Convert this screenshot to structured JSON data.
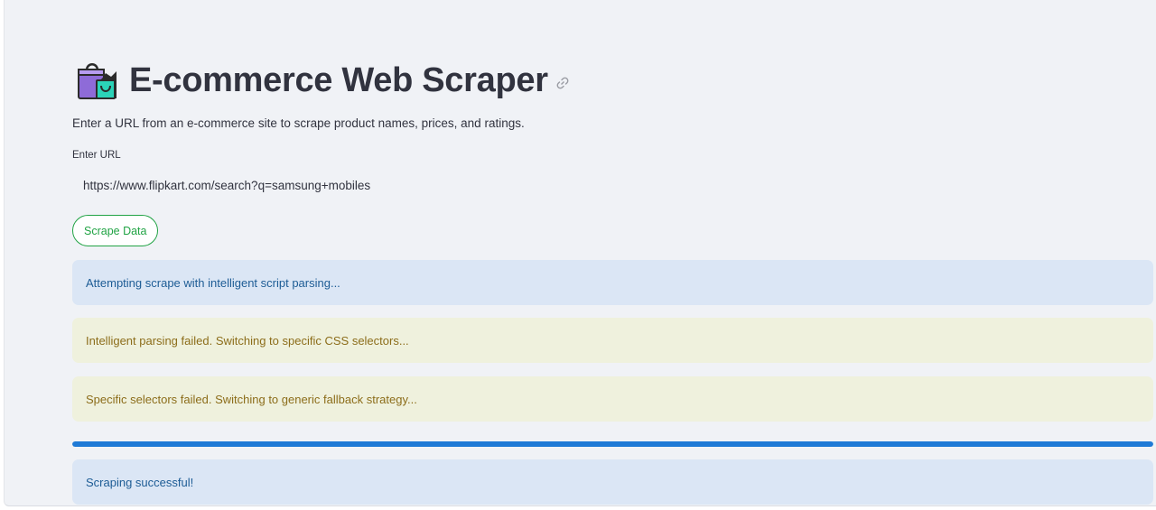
{
  "header": {
    "title": "E-commerce Web Scraper",
    "icon": "shopping-bags-icon",
    "anchor_icon": "link-icon"
  },
  "description": "Enter a URL from an e-commerce site to scrape product names, prices, and ratings.",
  "url_field": {
    "label": "Enter URL",
    "value": "https://www.flipkart.com/search?q=samsung+mobiles"
  },
  "actions": {
    "scrape_label": "Scrape Data"
  },
  "messages": [
    {
      "type": "info",
      "text": "Attempting scrape with intelligent script parsing..."
    },
    {
      "type": "warning",
      "text": "Intelligent parsing failed. Switching to specific CSS selectors..."
    },
    {
      "type": "warning",
      "text": "Specific selectors failed. Switching to generic fallback strategy..."
    }
  ],
  "progress": {
    "value_percent": 100,
    "color": "#1f7ad6"
  },
  "result": {
    "type": "info",
    "text": "Scraping successful!"
  },
  "colors": {
    "background": "#f0f2f6",
    "accent_green": "#21a344",
    "info_bg": "#dbe6f5",
    "info_text": "#1d5c95",
    "warning_bg": "#eff1dd",
    "warning_text": "#8c6d1a"
  }
}
